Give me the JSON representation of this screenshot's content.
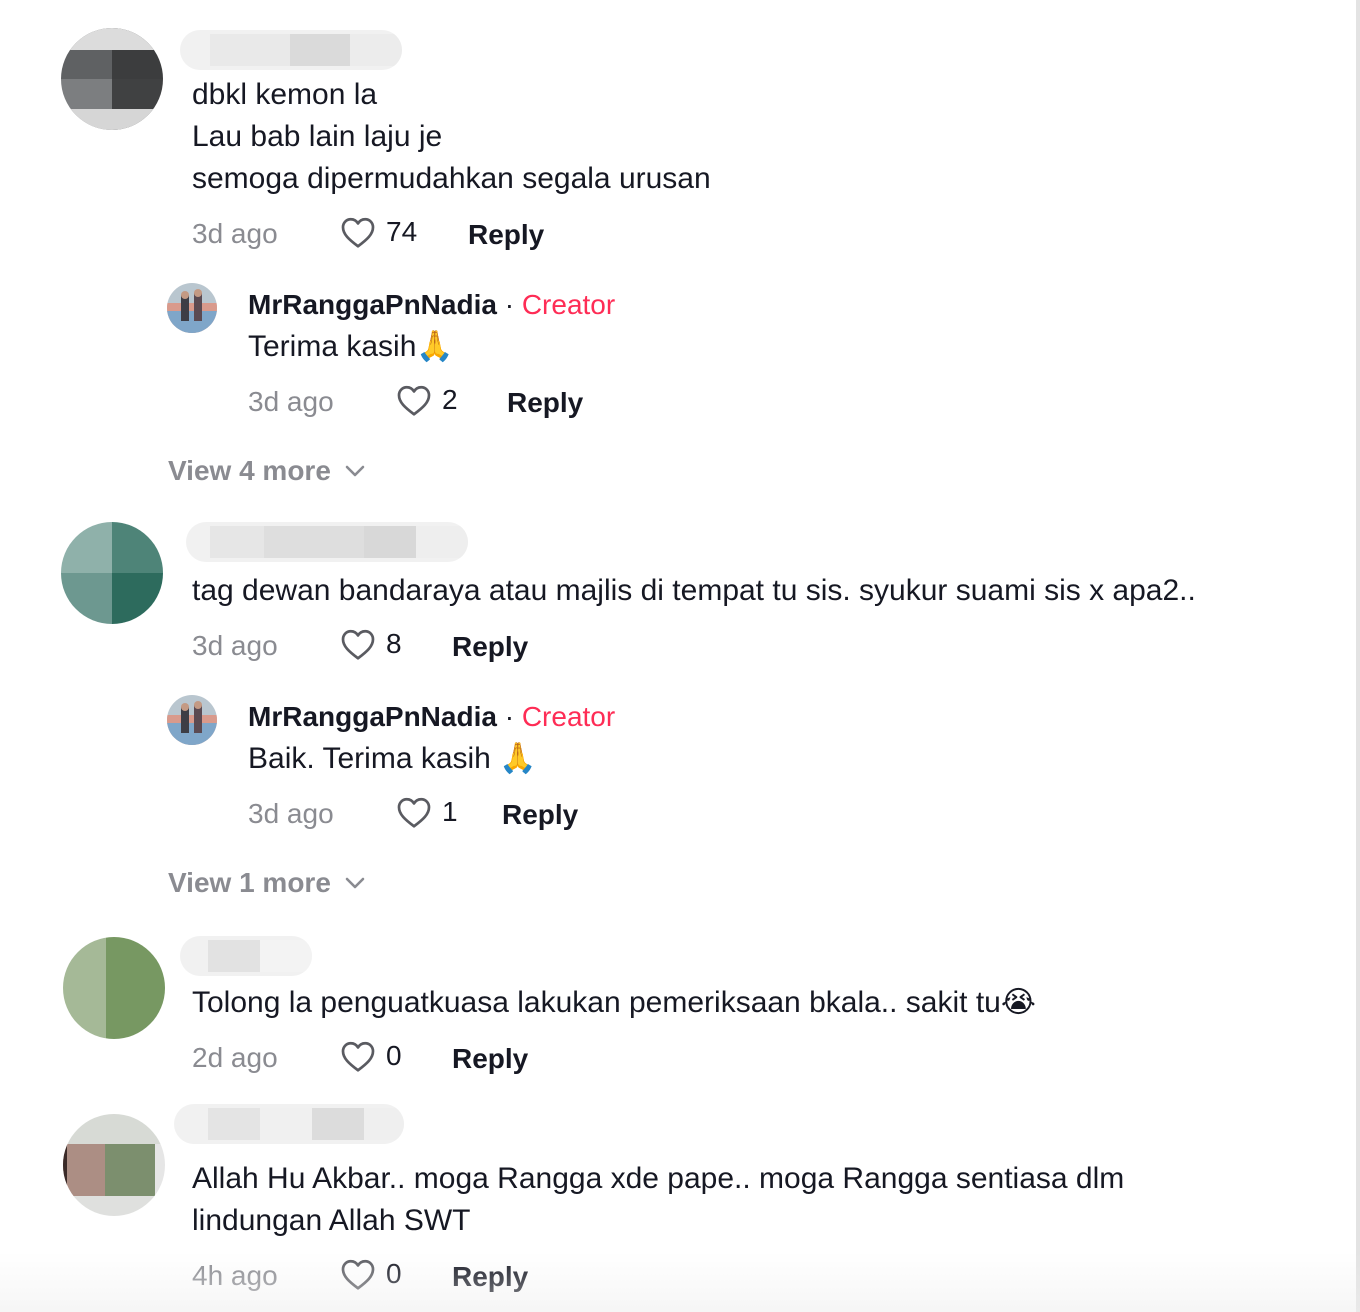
{
  "colors": {
    "creator_tag": "#fe2c55",
    "text": "#161823",
    "muted": "#8a8b91"
  },
  "comments": [
    {
      "lines": [
        "dbkl kemon la",
        "Lau bab lain laju je",
        "semoga dipermudahkan segala urusan"
      ],
      "time": "3d ago",
      "likes": "74",
      "reply": "Reply",
      "creator_reply": {
        "name": "MrRanggaPnNadia",
        "separator": "·",
        "tag": "Creator",
        "text": "Terima kasih",
        "emoji": "🙏",
        "time": "3d ago",
        "likes": "2",
        "reply": "Reply"
      },
      "view_more": "View 4 more"
    },
    {
      "lines": [
        "tag dewan bandaraya atau majlis di tempat tu sis. syukur suami sis x apa2.."
      ],
      "time": "3d ago",
      "likes": "8",
      "reply": "Reply",
      "creator_reply": {
        "name": "MrRanggaPnNadia",
        "separator": "·",
        "tag": "Creator",
        "text": "Baik. Terima kasih ",
        "emoji": "🙏",
        "time": "3d ago",
        "likes": "1",
        "reply": "Reply"
      },
      "view_more": "View 1 more"
    },
    {
      "lines": [
        "Tolong la penguatkuasa lakukan pemeriksaan bkala.. sakit tu"
      ],
      "emoji": "😭",
      "time": "2d ago",
      "likes": "0",
      "reply": "Reply"
    },
    {
      "lines": [
        "Allah Hu Akbar.. moga Rangga xde pape.. moga Rangga sentiasa dlm",
        "lindungan Allah SWT"
      ],
      "time": "4h ago",
      "likes": "0",
      "reply": "Reply"
    }
  ],
  "icons": {
    "like": "heart-outline-icon",
    "expand": "chevron-down-icon"
  }
}
